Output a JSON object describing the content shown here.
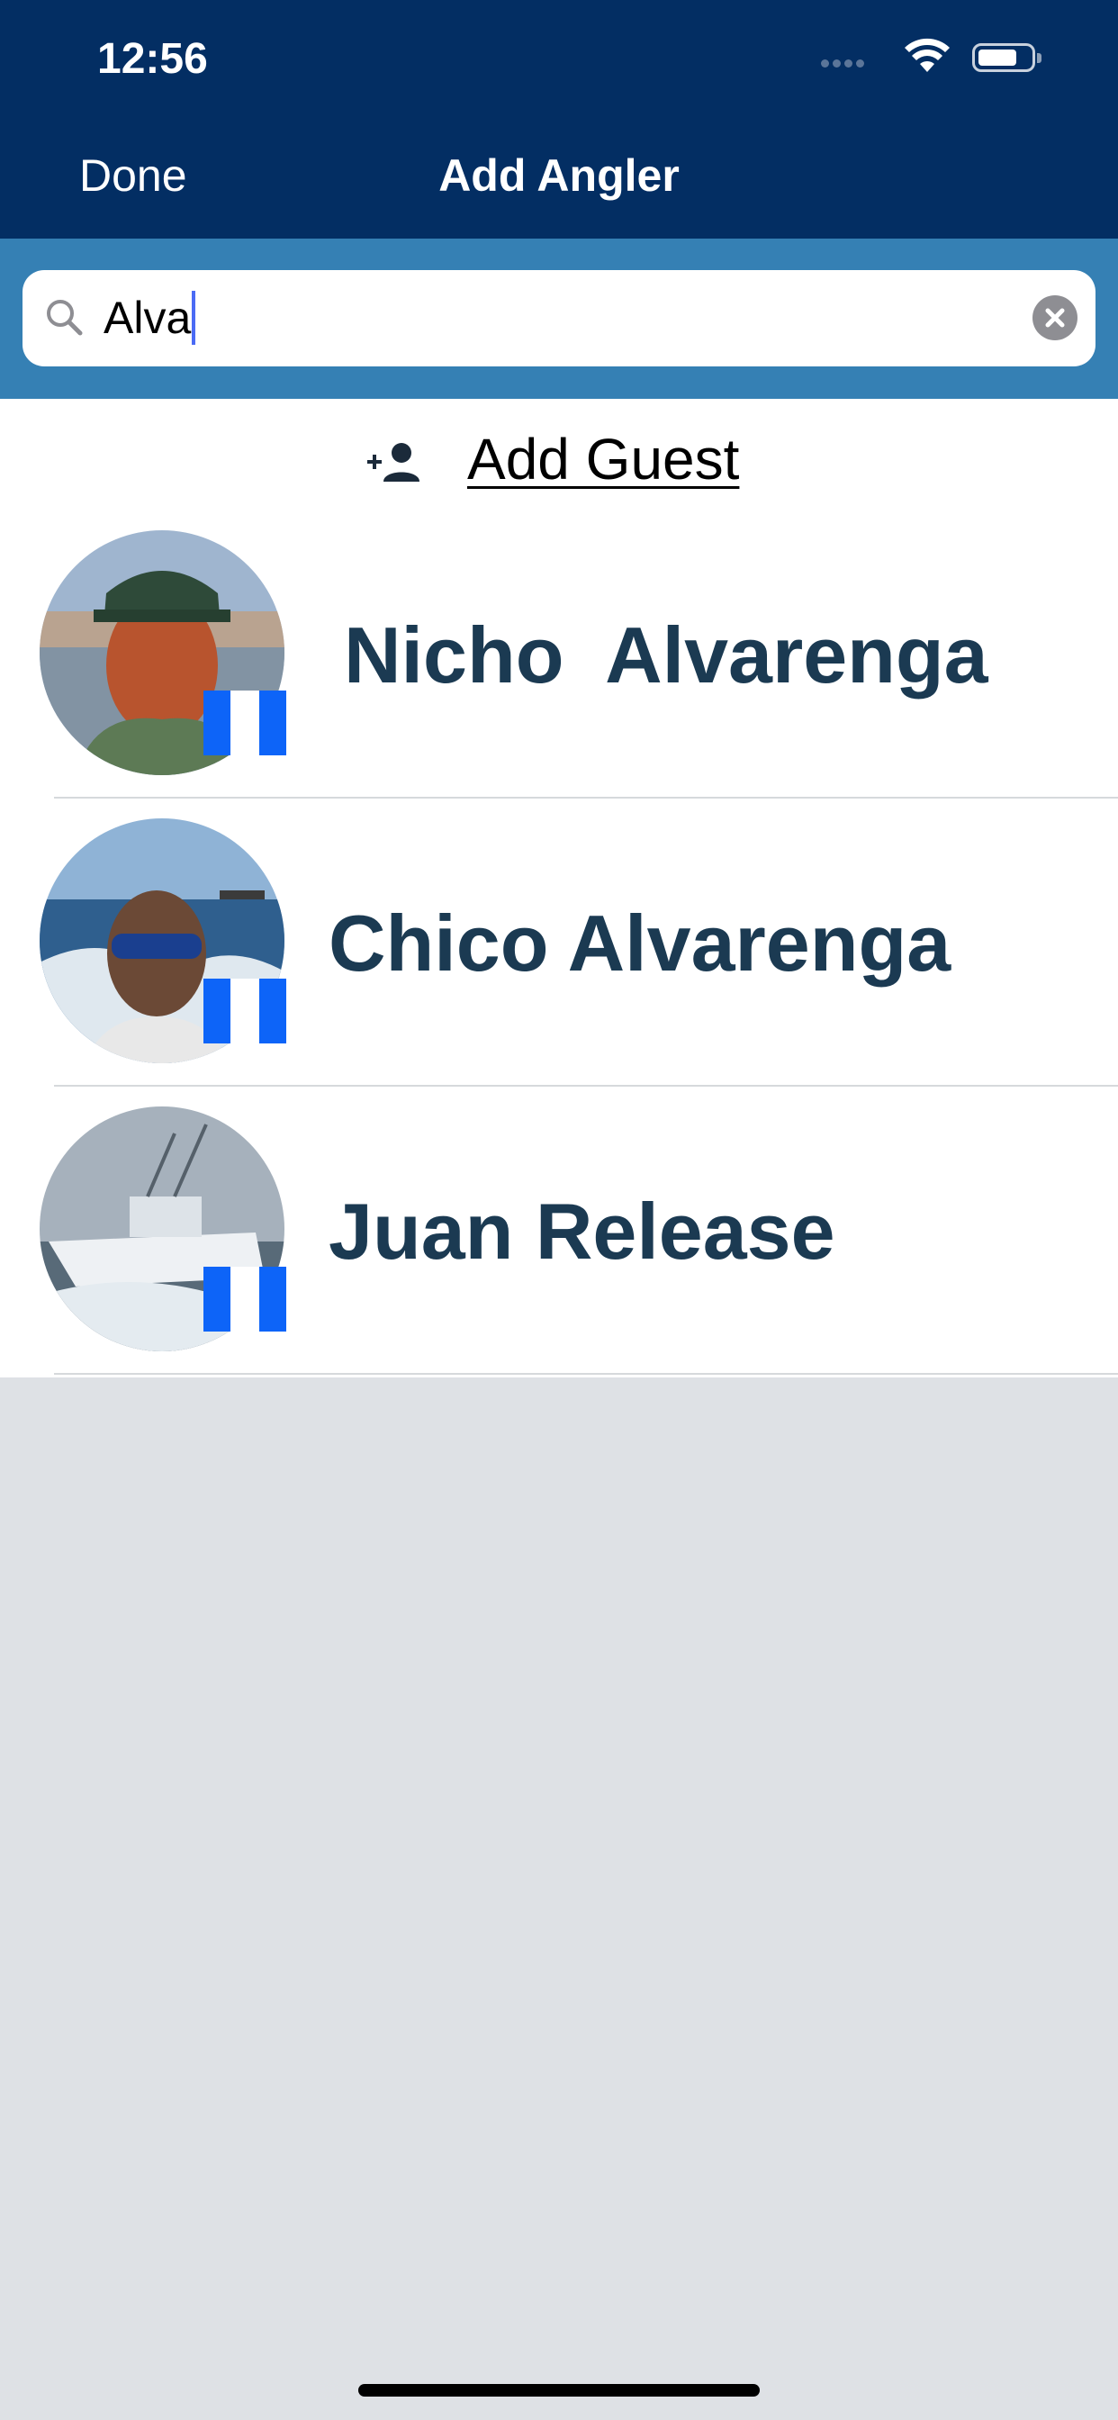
{
  "status_bar": {
    "time": "12:56",
    "icons": [
      "cellular-signal-icon",
      "wifi-icon",
      "battery-icon"
    ]
  },
  "nav": {
    "done_label": "Done",
    "title": "Add Angler"
  },
  "search": {
    "value": "Alva",
    "icon": "search-icon",
    "clear_icon": "clear-icon"
  },
  "add_guest": {
    "label": "Add Guest",
    "icon": "add-person-icon"
  },
  "anglers": [
    {
      "name": "Nicho  Alvarenga",
      "flag": "guatemala-flag-icon"
    },
    {
      "name": "Chico Alvarenga",
      "flag": "guatemala-flag-icon"
    },
    {
      "name": "Juan Release",
      "flag": "guatemala-flag-icon"
    }
  ],
  "colors": {
    "header": "#032e63",
    "search_bar": "#3580b4",
    "name_text": "#1b3a52",
    "flag_blue": "#0d64f8",
    "background": "#dee1e5"
  }
}
